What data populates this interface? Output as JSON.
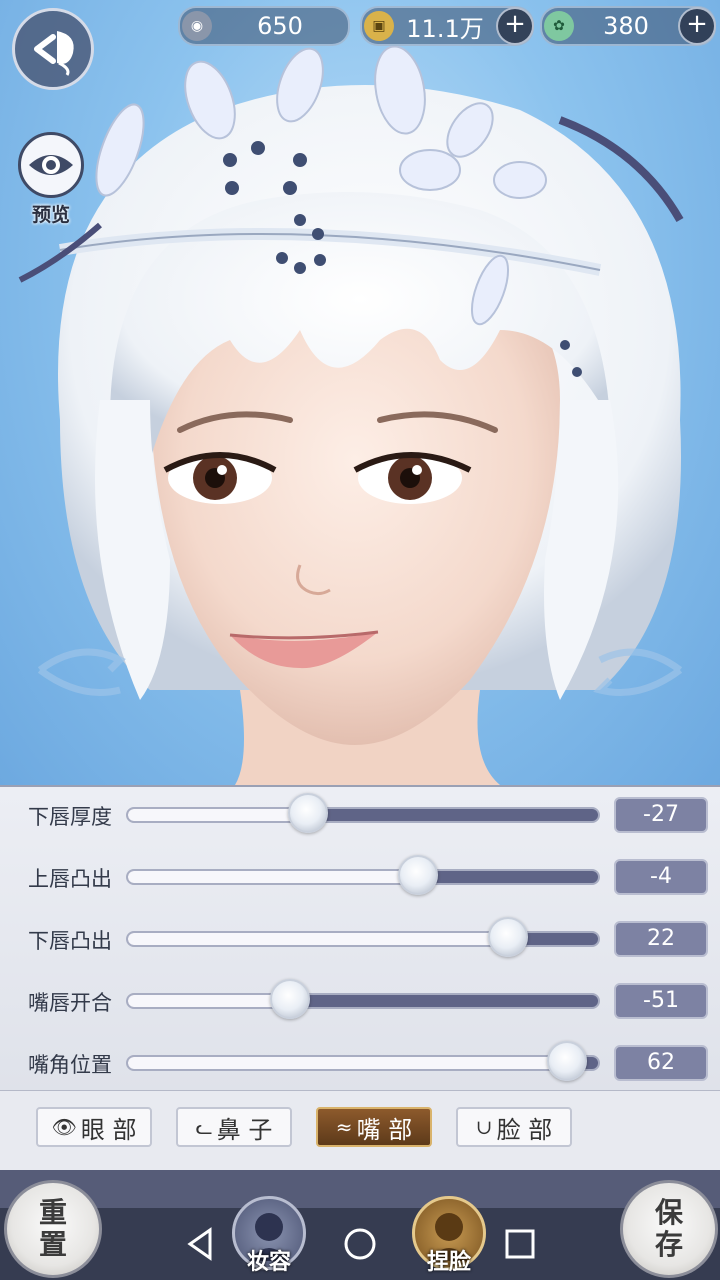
{
  "currencies": [
    {
      "value": "650",
      "icon": "silver-coin-icon",
      "has_plus": false
    },
    {
      "value": "11.1万",
      "icon": "copper-coin-icon",
      "has_plus": true
    },
    {
      "value": "380",
      "icon": "jade-icon",
      "has_plus": true
    }
  ],
  "preview_label": "预览",
  "sliders": [
    {
      "label": "下唇厚度",
      "value": "-27",
      "fraction": 0.385
    },
    {
      "label": "上唇凸出",
      "value": "-4",
      "fraction": 0.615
    },
    {
      "label": "下唇凸出",
      "value": "22",
      "fraction": 0.805
    },
    {
      "label": "嘴唇开合",
      "value": "-51",
      "fraction": 0.345
    },
    {
      "label": "嘴角位置",
      "value": "62",
      "fraction": 0.93
    }
  ],
  "tabs": [
    {
      "label": "眼 部",
      "icon": "eye-icon",
      "active": false
    },
    {
      "label": "鼻 子",
      "icon": "nose-icon",
      "active": false
    },
    {
      "label": "嘴 部",
      "icon": "mouth-icon",
      "active": true
    },
    {
      "label": "脸 部",
      "icon": "face-icon",
      "active": false
    }
  ],
  "bottom": {
    "reset_label": "重\n置",
    "makeup_label": "妆容",
    "face_label": "捏脸",
    "save_label": "保\n存"
  },
  "colors": {
    "accent": "#8d5a2c",
    "track": "#5f6487",
    "value_box": "#7d82a3"
  }
}
